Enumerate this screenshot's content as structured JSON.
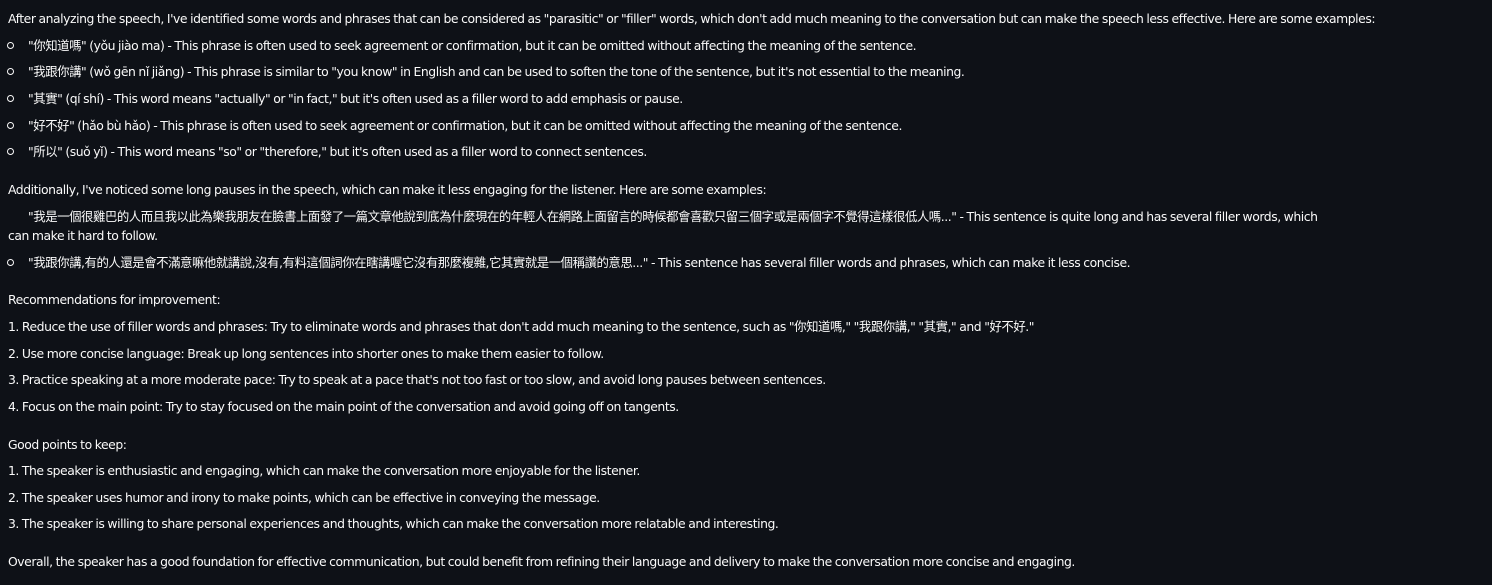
{
  "intro": "After analyzing the speech, I've identified some words and phrases that can be considered as \"parasitic\" or \"filler\" words, which don't add much meaning to the conversation but can make the speech less effective. Here are some examples:",
  "filler_examples": [
    "\"你知道嗎\" (yǒu jiào ma) - This phrase is often used to seek agreement or confirmation, but it can be omitted without affecting the meaning of the sentence.",
    "\"我跟你講\" (wǒ gēn nǐ jiǎng) - This phrase is similar to \"you know\" in English and can be used to soften the tone of the sentence, but it's not essential to the meaning.",
    "\"其實\" (qí shí) - This word means \"actually\" or \"in fact,\" but it's often used as a filler word to add emphasis or pause.",
    "\"好不好\" (hǎo bù hǎo) - This phrase is often used to seek agreement or confirmation, but it can be omitted without affecting the meaning of the sentence.",
    "\"所以\" (suǒ yǐ) - This word means \"so\" or \"therefore,\" but it's often used as a filler word to connect sentences."
  ],
  "pauses_intro": "Additionally, I've noticed some long pauses in the speech, which can make it less engaging for the listener. Here are some examples:",
  "pause_examples": {
    "first_line": "\"我是一個很雞巴的人而且我以此為樂我朋友在臉書上面發了一篇文章他說到底為什麼現在的年輕人在網路上面留言的時候都會喜歡只留三個字或是兩個字不覺得這樣很低人嗎...\" - This sentence is quite long and has several filler words, which",
    "first_line_cont": "can make it hard to follow.",
    "second": "\"我跟你講,有的人還是會不滿意嘛他就講說,沒有,有料這個詞你在瞎講喔它沒有那麼複雜,它其實就是一個稱讚的意思...\" - This sentence has several filler words and phrases, which can make it less concise."
  },
  "recommendations_heading": "Recommendations for improvement:",
  "recommendations": [
    "1. Reduce the use of filler words and phrases: Try to eliminate words and phrases that don't add much meaning to the sentence, such as \"你知道嗎,\" \"我跟你講,\" \"其實,\" and \"好不好.\"",
    "2. Use more concise language: Break up long sentences into shorter ones to make them easier to follow.",
    "3. Practice speaking at a more moderate pace: Try to speak at a pace that's not too fast or too slow, and avoid long pauses between sentences.",
    "4. Focus on the main point: Try to stay focused on the main point of the conversation and avoid going off on tangents."
  ],
  "good_points_heading": "Good points to keep:",
  "good_points": [
    "1. The speaker is enthusiastic and engaging, which can make the conversation more enjoyable for the listener.",
    "2. The speaker uses humor and irony to make points, which can be effective in conveying the message.",
    "3. The speaker is willing to share personal experiences and thoughts, which can make the conversation more relatable and interesting."
  ],
  "overall": "Overall, the speaker has a good foundation for effective communication, but could benefit from refining their language and delivery to make the conversation more concise and engaging."
}
